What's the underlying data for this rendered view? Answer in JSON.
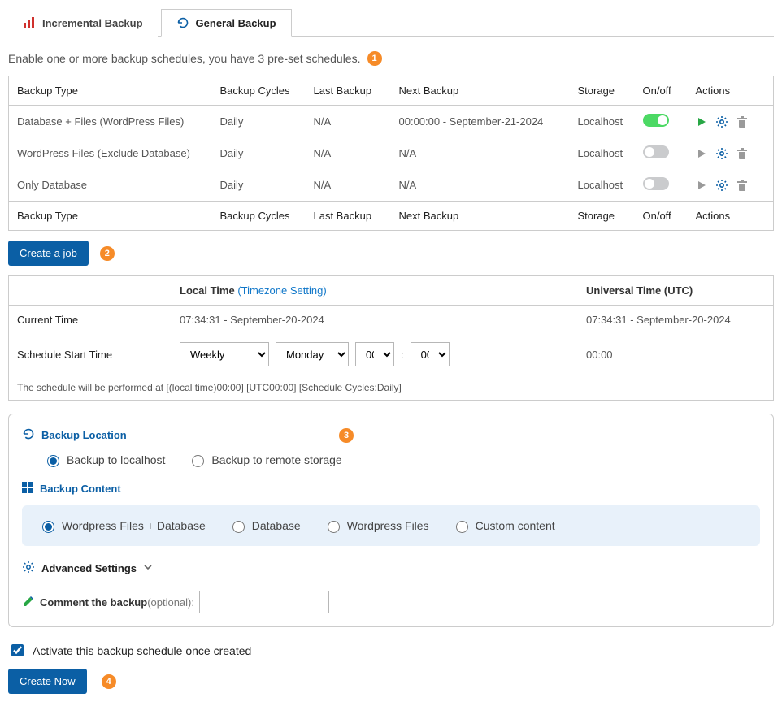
{
  "tabs": {
    "incremental": "Incremental Backup",
    "general": "General Backup"
  },
  "intro_text": "Enable one or more backup schedules, you have 3 pre-set schedules.",
  "badges": {
    "b1": "1",
    "b2": "2",
    "b3": "3",
    "b4": "4"
  },
  "table": {
    "headers": {
      "type": "Backup Type",
      "cycles": "Backup Cycles",
      "last": "Last Backup",
      "next": "Next Backup",
      "storage": "Storage",
      "onoff": "On/off",
      "actions": "Actions"
    },
    "rows": [
      {
        "type": "Database + Files (WordPress Files)",
        "cycles": "Daily",
        "last": "N/A",
        "next": "00:00:00 - September-21-2024",
        "storage": "Localhost",
        "on": true
      },
      {
        "type": "WordPress Files (Exclude Database)",
        "cycles": "Daily",
        "last": "N/A",
        "next": "N/A",
        "storage": "Localhost",
        "on": false
      },
      {
        "type": "Only Database",
        "cycles": "Daily",
        "last": "N/A",
        "next": "N/A",
        "storage": "Localhost",
        "on": false
      }
    ]
  },
  "buttons": {
    "create_job": "Create a job",
    "create_now": "Create Now"
  },
  "time": {
    "local_label": "Local Time",
    "tz_link": "(Timezone Setting)",
    "utc_label": "Universal Time (UTC)",
    "current_time_label": "Current Time",
    "current_local": "07:34:31 - September-20-2024",
    "current_utc": "07:34:31 - September-20-2024",
    "start_label": "Schedule Start Time",
    "freq_options": [
      "Weekly"
    ],
    "freq_value": "Weekly",
    "day_options": [
      "Monday"
    ],
    "day_value": "Monday",
    "hour_options": [
      "00"
    ],
    "hour_value": "00",
    "minute_options": [
      "00"
    ],
    "minute_value": "00",
    "utc_start": "00:00",
    "note": "The schedule will be performed at [(local time)00:00] [UTC00:00] [Schedule Cycles:Daily]"
  },
  "location": {
    "title": "Backup Location",
    "opt_local": "Backup to localhost",
    "opt_remote": "Backup to remote storage"
  },
  "content": {
    "title": "Backup Content",
    "opt_files_db": "Wordpress Files + Database",
    "opt_db": "Database",
    "opt_files": "Wordpress Files",
    "opt_custom": "Custom content"
  },
  "advanced": {
    "title": "Advanced Settings"
  },
  "comment": {
    "label": "Comment the backup",
    "optional": "(optional):",
    "value": ""
  },
  "activate_label": "Activate this backup schedule once created"
}
